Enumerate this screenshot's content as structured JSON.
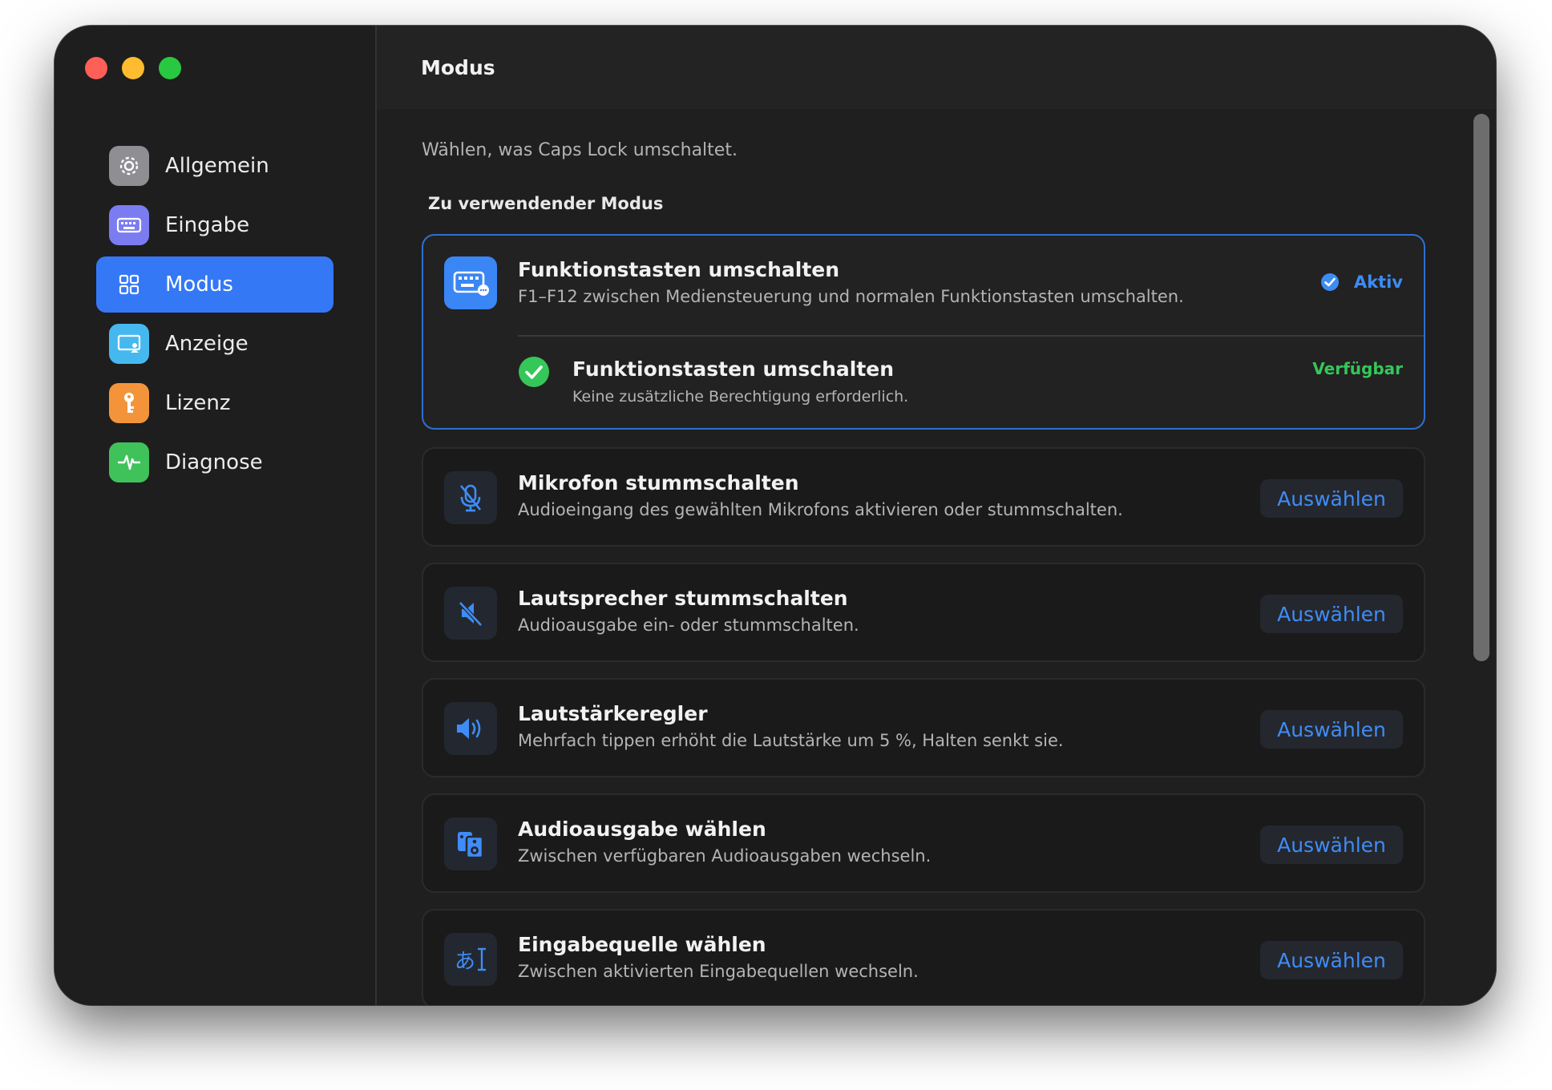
{
  "window": {
    "title": "Modus"
  },
  "sidebar": {
    "items": [
      {
        "label": "Allgemein",
        "icon": "gear-icon",
        "color": "#8e8e93",
        "active": false
      },
      {
        "label": "Eingabe",
        "icon": "keyboard-icon",
        "color": "#7c7cf2",
        "active": false
      },
      {
        "label": "Modus",
        "icon": "grid-icon",
        "color": "#3478f6",
        "active": true
      },
      {
        "label": "Anzeige",
        "icon": "display-icon",
        "color": "#46b8f0",
        "active": false
      },
      {
        "label": "Lizenz",
        "icon": "key-icon",
        "color": "#f4943a",
        "active": false
      },
      {
        "label": "Diagnose",
        "icon": "waveform-icon",
        "color": "#40c25a",
        "active": false
      }
    ]
  },
  "main": {
    "intro": "Wählen, was Caps Lock umschaltet.",
    "section_label": "Zu verwendender Modus",
    "active_mode": {
      "title": "Funktionstasten umschalten",
      "description": "F1–F12 zwischen Mediensteuerung und normalen Funktionstasten umschalten.",
      "status": "Aktiv",
      "icon": "keyboard-icon",
      "permission": {
        "title": "Funktionstasten umschalten",
        "description": "Keine zusätzliche Berechtigung erforderlich.",
        "status": "Verfügbar",
        "icon": "checkmark-circle-icon"
      }
    },
    "modes": [
      {
        "title": "Mikrofon stummschalten",
        "description": "Audioeingang des gewählten Mikrofons aktivieren oder stummschalten.",
        "button": "Auswählen",
        "icon": "mic-slash-icon"
      },
      {
        "title": "Lautsprecher stummschalten",
        "description": "Audioausgabe ein- oder stummschalten.",
        "button": "Auswählen",
        "icon": "speaker-slash-icon"
      },
      {
        "title": "Lautstärkeregler",
        "description": "Mehrfach tippen erhöht die Lautstärke um 5 %, Halten senkt sie.",
        "button": "Auswählen",
        "icon": "speaker-wave-icon"
      },
      {
        "title": "Audioausgabe wählen",
        "description": "Zwischen verfügbaren Audioausgaben wechseln.",
        "button": "Auswählen",
        "icon": "speakers-icon"
      },
      {
        "title": "Eingabequelle wählen",
        "description": "Zwischen aktivierten Eingabequellen wechseln.",
        "button": "Auswählen",
        "icon": "input-source-icon",
        "icon_glyph": "あ"
      }
    ]
  },
  "colors": {
    "accent": "#3478f6",
    "active_status": "#3d8cf5",
    "available_status": "#35c759"
  }
}
